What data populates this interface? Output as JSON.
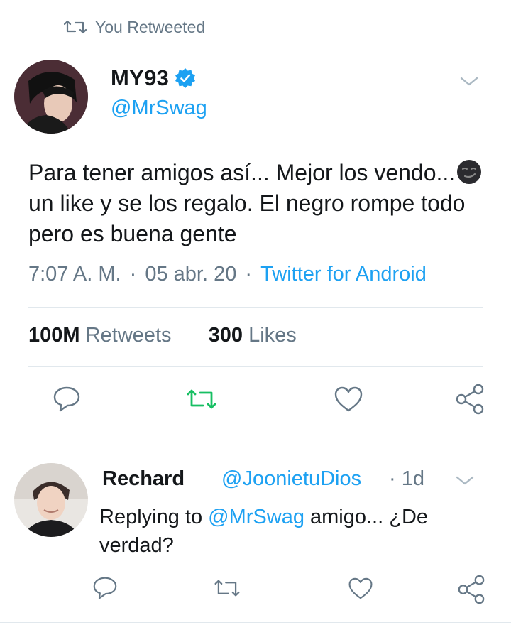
{
  "retweet_banner": {
    "label": "You Retweeted",
    "icon": "retweet-icon"
  },
  "tweet": {
    "name": "MY93",
    "verified": true,
    "handle": "@MrSwag",
    "text_part1": "Para tener amigos así... Mejor los vendo...",
    "emoji": "smirking-face-emoji",
    "text_part2": " un like y se los regalo. El negro rompe todo pero es buena gente",
    "time": "7:07 A. M.",
    "date": "05 abr. 20",
    "source": "Twitter for Android",
    "retweets_count": "100M",
    "retweets_label": "Retweets",
    "likes_count": "300",
    "likes_label": "Likes"
  },
  "reply": {
    "name": "Rechard",
    "handle": "@JoonietuDios",
    "time": "· 1d",
    "replying_prefix": "Replying to ",
    "replying_handle": "@MrSwag",
    "text": " amigo... ¿De verdad?"
  },
  "colors": {
    "accent": "#1da1f2",
    "retweeted": "#17bf63",
    "muted": "#657786",
    "divider": "#e1e8ed"
  }
}
